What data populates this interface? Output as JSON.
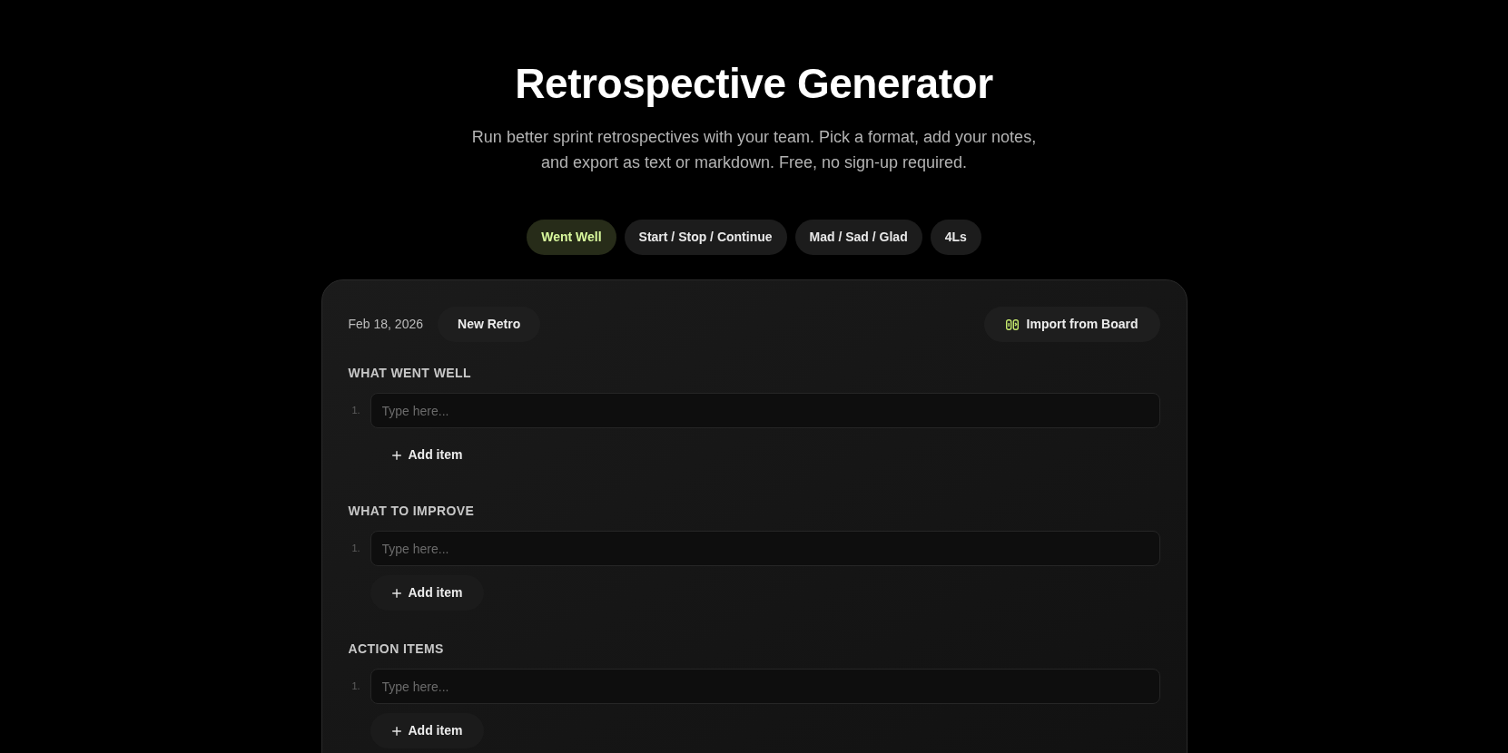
{
  "page": {
    "title": "Retrospective Generator",
    "subtitle": "Run better sprint retrospectives with your team. Pick a format, add your notes, and export as text or markdown. Free, no sign-up required."
  },
  "format_tabs": [
    {
      "label": "Went Well",
      "selected": true
    },
    {
      "label": "Start / Stop / Continue",
      "selected": false
    },
    {
      "label": "Mad / Sad / Glad",
      "selected": false
    },
    {
      "label": "4Ls",
      "selected": false
    }
  ],
  "retro": {
    "date": "Feb 18, 2026",
    "new_button": "New Retro",
    "import_button": "Import from Board",
    "sections": [
      {
        "heading": "WHAT WENT WELL",
        "items": [
          {
            "number": "1.",
            "placeholder": "Type here..."
          }
        ],
        "add_button": {
          "label": "Add item",
          "kind": "ghost"
        }
      },
      {
        "heading": "WHAT TO IMPROVE",
        "items": [
          {
            "number": "1.",
            "placeholder": "Type here..."
          }
        ],
        "add_button": {
          "label": "Add item",
          "kind": "filled"
        }
      },
      {
        "heading": "ACTION ITEMS",
        "items": [
          {
            "number": "1.",
            "placeholder": "Type here..."
          }
        ],
        "add_button": {
          "label": "Add item",
          "kind": "filled"
        }
      }
    ]
  }
}
